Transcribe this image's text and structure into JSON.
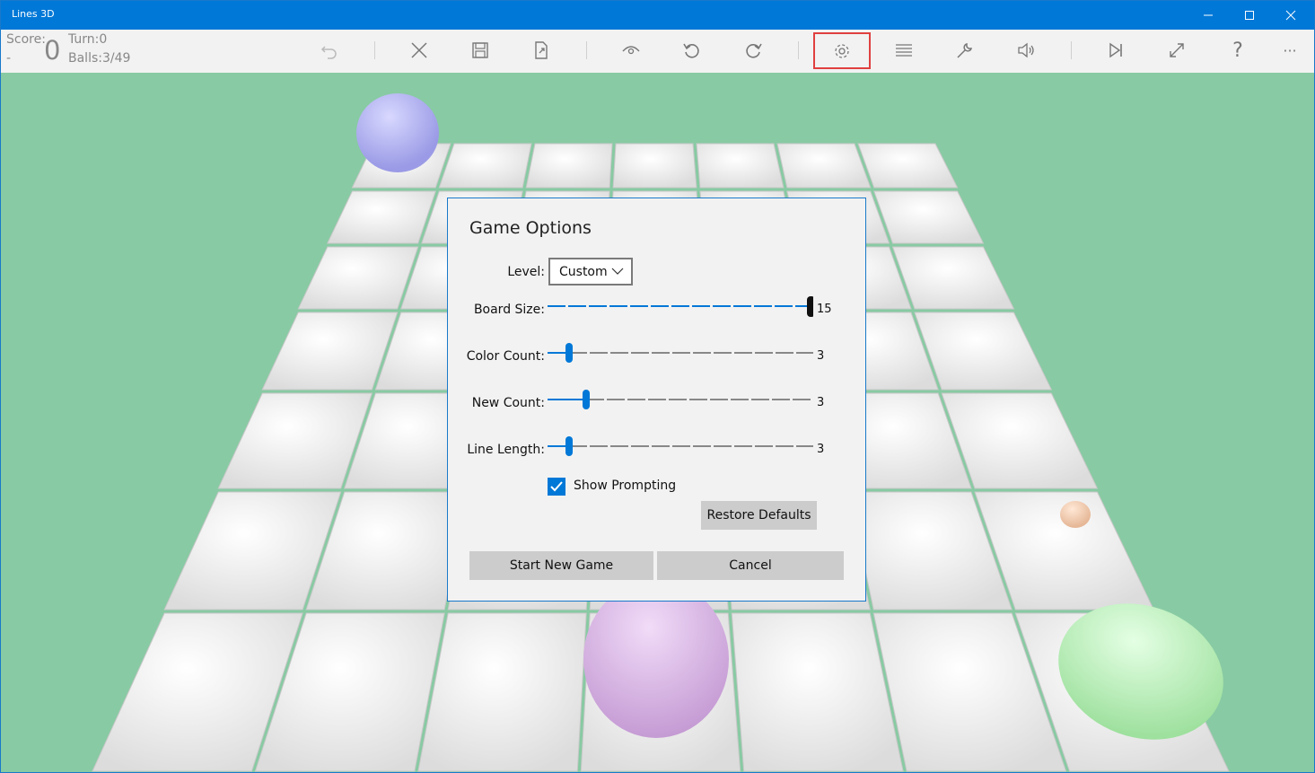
{
  "window": {
    "title": "Lines 3D"
  },
  "stats": {
    "score_label": "Score:",
    "score_sub": "-",
    "score_value": "0",
    "turn": "Turn:0",
    "balls": "Balls:3/49"
  },
  "toolbar": {
    "help_glyph": "?",
    "more_glyph": "···",
    "icons": [
      "undo-icon",
      "close-x-icon",
      "save-icon",
      "export-icon",
      "eye-icon",
      "rotate-left-icon",
      "rotate-right-icon",
      "gear-icon",
      "list-icon",
      "wrench-icon",
      "speaker-icon",
      "skip-next-icon",
      "resize-icon",
      "help-icon",
      "more-icon"
    ]
  },
  "dialog": {
    "title": "Game Options",
    "level_label": "Level:",
    "level_value": "Custom",
    "board_size_label": "Board Size:",
    "board_size_value": "15",
    "color_count_label": "Color Count:",
    "color_count_value": "3",
    "new_count_label": "New Count:",
    "new_count_value": "3",
    "line_length_label": "Line Length:",
    "line_length_value": "3",
    "show_prompting_label": "Show Prompting",
    "show_prompting_checked": true,
    "restore_defaults": "Restore Defaults",
    "start_new_game": "Start New Game",
    "cancel": "Cancel"
  },
  "colors": {
    "titlebar": "#0078d7",
    "accent": "#0078d7",
    "background_green": "#88caa3",
    "highlight_box": "#e04040"
  }
}
